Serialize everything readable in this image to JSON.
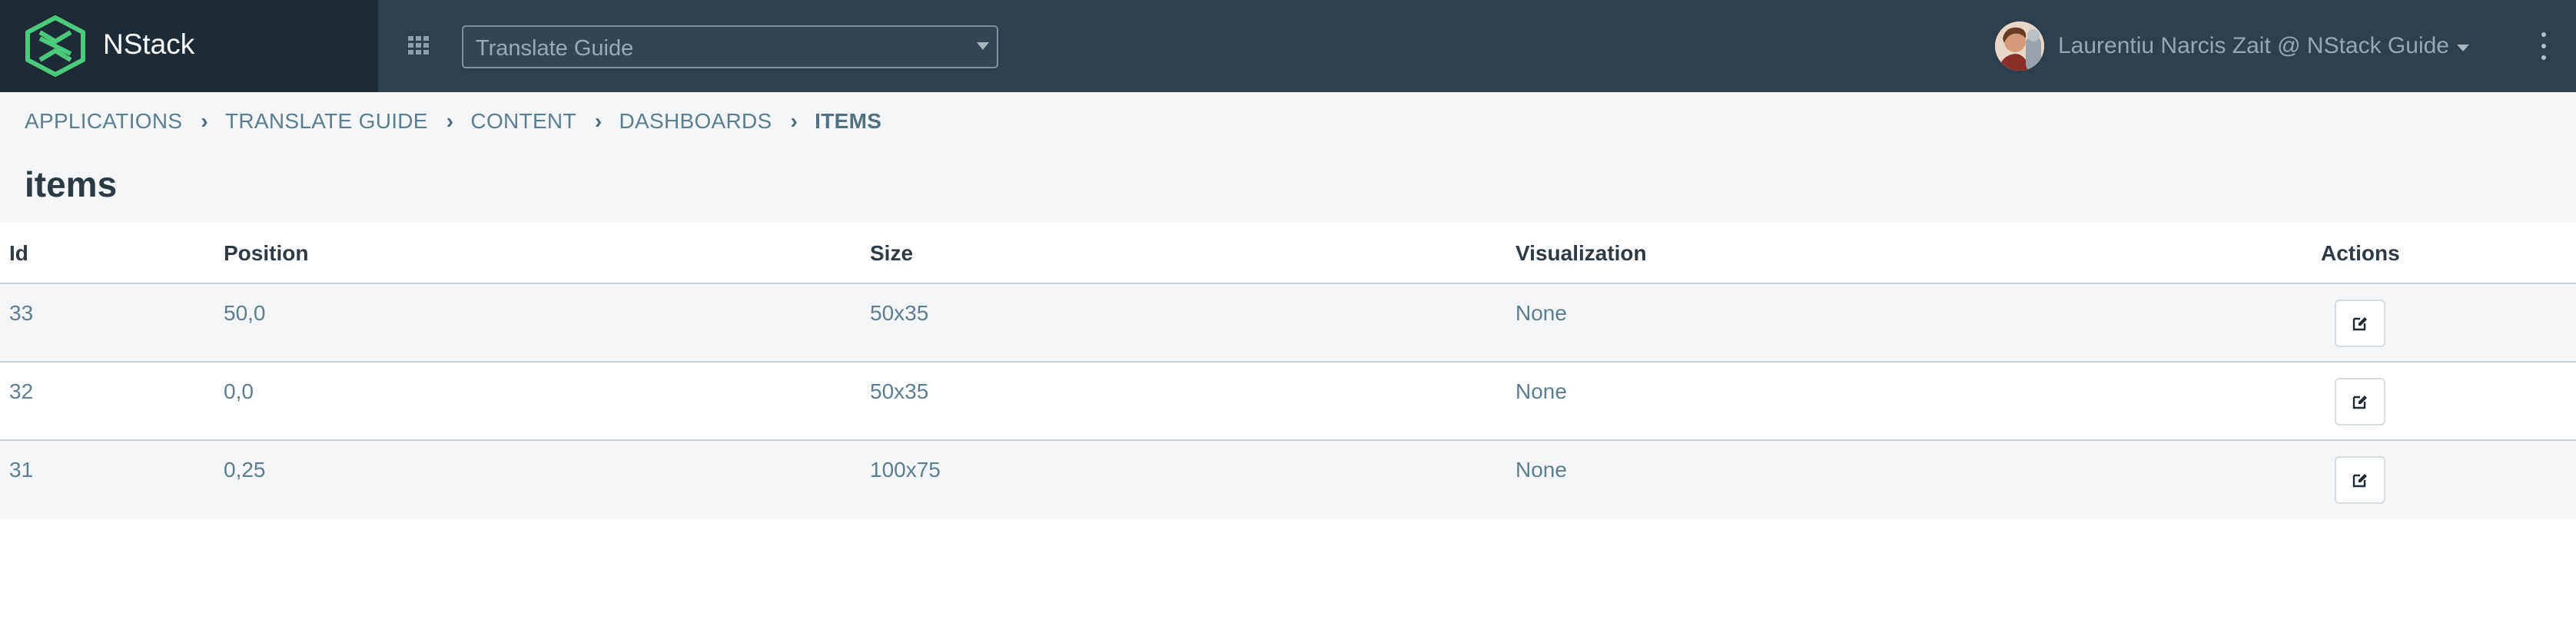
{
  "brand": {
    "name": "NStack"
  },
  "app_selector": {
    "value": "Translate Guide"
  },
  "user": {
    "label": "Laurentiu Narcis Zait @ NStack Guide"
  },
  "breadcrumb": [
    {
      "label": "APPLICATIONS"
    },
    {
      "label": "TRANSLATE GUIDE"
    },
    {
      "label": "CONTENT"
    },
    {
      "label": "DASHBOARDS"
    },
    {
      "label": "ITEMS"
    }
  ],
  "page": {
    "title": "items"
  },
  "table": {
    "columns": [
      "Id",
      "Position",
      "Size",
      "Visualization",
      "Actions"
    ],
    "rows": [
      {
        "id": "33",
        "position": "50,0",
        "size": "50x35",
        "visualization": "None"
      },
      {
        "id": "32",
        "position": "0,0",
        "size": "50x35",
        "visualization": "None"
      },
      {
        "id": "31",
        "position": "0,25",
        "size": "100x75",
        "visualization": "None"
      }
    ]
  },
  "icons": {
    "logo": "nstack-logo-icon",
    "apps": "apps-grid-icon",
    "menu": "kebab-menu-icon",
    "edit": "edit-icon"
  },
  "colors": {
    "topbar": "#2e3f4d",
    "brand_bg": "#1d2b36",
    "brand_accent": "#4cc97a",
    "link": "#5d7e8f",
    "subheader_bg": "#f4f6f7"
  }
}
